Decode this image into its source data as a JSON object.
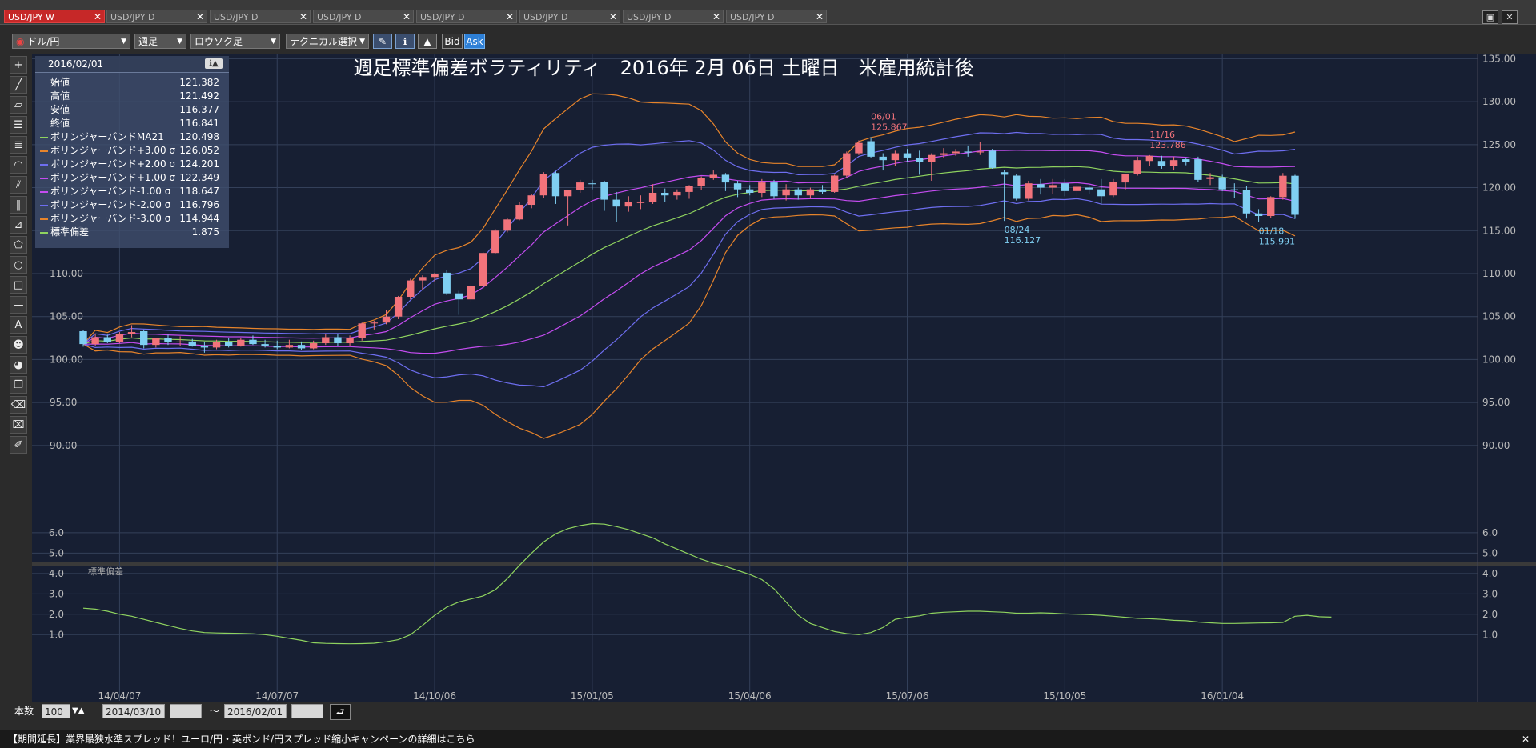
{
  "tabs": [
    {
      "label": "USD/JPY W",
      "active": true
    },
    {
      "label": "USD/JPY D",
      "active": false
    },
    {
      "label": "USD/JPY D",
      "active": false
    },
    {
      "label": "USD/JPY D",
      "active": false
    },
    {
      "label": "USD/JPY D",
      "active": false
    },
    {
      "label": "USD/JPY D",
      "active": false
    },
    {
      "label": "USD/JPY D",
      "active": false
    },
    {
      "label": "USD/JPY D",
      "active": false
    }
  ],
  "toolbar": {
    "pair": "ドル/円",
    "period": "週足",
    "chart_style": "ロウソク足",
    "technical": "テクニカル選択",
    "bid": "Bid",
    "ask": "Ask"
  },
  "info": {
    "date": "2016/02/01",
    "rows": [
      {
        "label": "始値",
        "value": "121.382",
        "color": ""
      },
      {
        "label": "高値",
        "value": "121.492",
        "color": ""
      },
      {
        "label": "安値",
        "value": "116.377",
        "color": ""
      },
      {
        "label": "終値",
        "value": "116.841",
        "color": ""
      },
      {
        "label": "ボリンジャーバンドMA21",
        "value": "120.498",
        "color": "#8fd35f"
      },
      {
        "label": "ボリンジャーバンド+3.00 σ",
        "value": "126.052",
        "color": "#e7842b"
      },
      {
        "label": "ボリンジャーバンド+2.00 σ",
        "value": "124.201",
        "color": "#6e6ef0"
      },
      {
        "label": "ボリンジャーバンド+1.00 σ",
        "value": "122.349",
        "color": "#c44cf0"
      },
      {
        "label": "ボリンジャーバンド-1.00 σ",
        "value": "118.647",
        "color": "#c44cf0"
      },
      {
        "label": "ボリンジャーバンド-2.00 σ",
        "value": "116.796",
        "color": "#6e6ef0"
      },
      {
        "label": "ボリンジャーバンド-3.00 σ",
        "value": "114.944",
        "color": "#e7842b"
      },
      {
        "label": "標準偏差",
        "value": "1.875",
        "color": "#8fd35f"
      }
    ]
  },
  "bottom": {
    "count_label": "本数",
    "count": "100",
    "from": "2014/03/10",
    "tilde": "～",
    "to": "2016/02/01"
  },
  "news": "【期間延長】業界最狭水準スプレッド！ユーロ/円・英ポンド/円スプレッド縮小キャンペーンの詳細はこちら",
  "chart_data": {
    "type": "line",
    "title": "週足標準偏差ボラティリティ　2016年 2月 06日 土曜日　米雇用統計後",
    "price_ylim": [
      88.5,
      135.5
    ],
    "price_yticks": [
      "135.00",
      "130.00",
      "125.00",
      "120.00",
      "115.00",
      "110.00",
      "105.00",
      "100.00",
      "95.00",
      "90.00"
    ],
    "std_ylim": [
      0.5,
      6.9
    ],
    "std_yticks": [
      "6.0",
      "5.0",
      "4.0",
      "3.0",
      "2.0",
      "1.0"
    ],
    "std_label": "標準偏差",
    "x_tick_labels": [
      {
        "label": "14/04/07",
        "index": 3
      },
      {
        "label": "14/07/07",
        "index": 16
      },
      {
        "label": "14/10/06",
        "index": 29
      },
      {
        "label": "15/01/05",
        "index": 42
      },
      {
        "label": "15/04/06",
        "index": 55
      },
      {
        "label": "15/07/06",
        "index": 68
      },
      {
        "label": "15/10/05",
        "index": 81
      },
      {
        "label": "16/01/04",
        "index": 94
      }
    ],
    "candles": [
      [
        103.3,
        103.4,
        101.5,
        101.8
      ],
      [
        101.8,
        103.0,
        101.6,
        102.6
      ],
      [
        102.6,
        102.9,
        101.9,
        102.0
      ],
      [
        102.0,
        103.2,
        101.9,
        103.0
      ],
      [
        103.0,
        104.0,
        102.6,
        103.2
      ],
      [
        103.3,
        103.5,
        101.3,
        101.7
      ],
      [
        101.7,
        102.5,
        101.4,
        102.5
      ],
      [
        102.5,
        102.9,
        101.7,
        102.0
      ],
      [
        102.0,
        102.7,
        101.6,
        102.1
      ],
      [
        102.1,
        102.4,
        101.5,
        101.6
      ],
      [
        101.6,
        102.0,
        100.8,
        101.4
      ],
      [
        101.4,
        102.3,
        101.2,
        102.0
      ],
      [
        102.0,
        102.5,
        101.4,
        101.6
      ],
      [
        101.6,
        102.5,
        101.5,
        102.3
      ],
      [
        102.3,
        102.8,
        101.7,
        101.8
      ],
      [
        101.8,
        102.3,
        101.4,
        101.6
      ],
      [
        101.6,
        102.2,
        101.2,
        101.4
      ],
      [
        101.4,
        102.3,
        101.3,
        101.7
      ],
      [
        101.7,
        102.1,
        101.1,
        101.3
      ],
      [
        101.3,
        102.2,
        101.2,
        101.9
      ],
      [
        101.9,
        103.0,
        101.7,
        102.6
      ],
      [
        102.6,
        103.0,
        101.6,
        101.9
      ],
      [
        101.9,
        102.8,
        101.6,
        102.5
      ],
      [
        102.5,
        104.3,
        102.2,
        104.2
      ],
      [
        104.2,
        104.5,
        103.5,
        104.3
      ],
      [
        104.3,
        105.8,
        104.1,
        105.0
      ],
      [
        105.0,
        107.4,
        104.7,
        107.3
      ],
      [
        107.3,
        109.4,
        107.0,
        109.2
      ],
      [
        109.2,
        109.8,
        108.1,
        109.6
      ],
      [
        109.6,
        110.1,
        109.0,
        110.0
      ],
      [
        110.1,
        110.4,
        107.5,
        107.7
      ],
      [
        107.7,
        108.0,
        105.2,
        107.0
      ],
      [
        107.0,
        108.8,
        106.7,
        108.6
      ],
      [
        108.6,
        112.5,
        108.3,
        112.4
      ],
      [
        112.4,
        115.2,
        112.3,
        115.0
      ],
      [
        115.0,
        116.5,
        114.8,
        116.3
      ],
      [
        116.3,
        118.3,
        116.2,
        118.0
      ],
      [
        118.0,
        119.3,
        117.6,
        119.1
      ],
      [
        119.1,
        121.8,
        118.8,
        121.6
      ],
      [
        121.7,
        121.9,
        118.1,
        119.0
      ],
      [
        119.0,
        119.7,
        115.6,
        119.7
      ],
      [
        119.7,
        120.9,
        119.4,
        120.6
      ],
      [
        120.5,
        120.9,
        119.8,
        120.4
      ],
      [
        120.7,
        120.8,
        117.3,
        118.6
      ],
      [
        118.6,
        119.5,
        116.0,
        117.8
      ],
      [
        117.8,
        119.0,
        117.2,
        118.3
      ],
      [
        118.3,
        119.1,
        117.5,
        118.3
      ],
      [
        118.3,
        120.4,
        118.1,
        119.4
      ],
      [
        119.4,
        119.9,
        118.3,
        119.1
      ],
      [
        119.1,
        119.8,
        118.6,
        119.5
      ],
      [
        119.5,
        120.3,
        118.7,
        120.2
      ],
      [
        120.2,
        121.3,
        119.7,
        121.1
      ],
      [
        121.1,
        122.0,
        120.9,
        121.5
      ],
      [
        121.5,
        121.7,
        119.6,
        120.6
      ],
      [
        120.5,
        120.8,
        118.9,
        119.8
      ],
      [
        119.8,
        120.3,
        119.1,
        119.4
      ],
      [
        119.4,
        121.0,
        118.9,
        120.6
      ],
      [
        120.6,
        120.9,
        118.7,
        119.0
      ],
      [
        119.1,
        120.4,
        118.5,
        119.8
      ],
      [
        119.8,
        120.0,
        118.6,
        119.1
      ],
      [
        119.1,
        120.0,
        118.7,
        119.8
      ],
      [
        119.8,
        120.3,
        119.3,
        119.5
      ],
      [
        119.5,
        121.5,
        119.4,
        121.4
      ],
      [
        121.4,
        124.2,
        121.2,
        124.0
      ],
      [
        124.0,
        125.5,
        123.8,
        125.2
      ],
      [
        125.4,
        125.867,
        123.5,
        123.6
      ],
      [
        123.6,
        124.0,
        122.0,
        123.2
      ],
      [
        123.2,
        124.3,
        122.5,
        124.0
      ],
      [
        124.0,
        124.5,
        123.0,
        123.5
      ],
      [
        123.4,
        124.3,
        121.5,
        123.0
      ],
      [
        123.0,
        124.0,
        120.8,
        123.8
      ],
      [
        123.8,
        124.6,
        123.4,
        124.0
      ],
      [
        124.0,
        124.5,
        123.7,
        124.2
      ],
      [
        124.2,
        124.9,
        123.6,
        124.1
      ],
      [
        124.1,
        125.3,
        123.8,
        124.2
      ],
      [
        124.3,
        124.5,
        122.2,
        122.3
      ],
      [
        121.8,
        122.1,
        116.127,
        121.5
      ],
      [
        121.4,
        121.6,
        118.5,
        118.7
      ],
      [
        118.7,
        120.8,
        118.5,
        120.5
      ],
      [
        120.4,
        121.0,
        119.2,
        120.0
      ],
      [
        120.0,
        121.0,
        119.3,
        120.3
      ],
      [
        120.5,
        121.0,
        119.0,
        119.6
      ],
      [
        119.6,
        120.5,
        118.7,
        120.1
      ],
      [
        120.0,
        120.3,
        119.3,
        119.8
      ],
      [
        119.8,
        121.0,
        118.1,
        119.0
      ],
      [
        119.1,
        121.0,
        118.9,
        120.7
      ],
      [
        120.6,
        121.5,
        119.8,
        121.6
      ],
      [
        121.6,
        123.6,
        121.4,
        123.2
      ],
      [
        123.1,
        123.786,
        122.5,
        123.7
      ],
      [
        123.1,
        123.7,
        122.2,
        122.5
      ],
      [
        122.5,
        123.6,
        122.0,
        123.2
      ],
      [
        123.3,
        123.5,
        122.6,
        123.0
      ],
      [
        123.3,
        123.6,
        120.7,
        120.9
      ],
      [
        121.0,
        121.7,
        120.3,
        121.2
      ],
      [
        121.2,
        121.5,
        119.6,
        119.8
      ],
      [
        119.8,
        120.5,
        118.8,
        119.7
      ],
      [
        119.7,
        120.2,
        116.4,
        117.0
      ],
      [
        117.0,
        117.5,
        115.991,
        116.7
      ],
      [
        116.7,
        119.0,
        116.5,
        118.9
      ],
      [
        118.9,
        121.7,
        118.6,
        121.382
      ],
      [
        121.382,
        121.492,
        116.377,
        116.841
      ]
    ],
    "std": [
      2.3,
      2.25,
      2.15,
      2.0,
      1.9,
      1.75,
      1.6,
      1.45,
      1.3,
      1.18,
      1.1,
      1.08,
      1.07,
      1.06,
      1.04,
      1.0,
      0.92,
      0.82,
      0.72,
      0.6,
      0.57,
      0.56,
      0.55,
      0.56,
      0.58,
      0.65,
      0.75,
      1.0,
      1.45,
      1.95,
      2.35,
      2.6,
      2.75,
      2.9,
      3.2,
      3.75,
      4.4,
      5.0,
      5.55,
      5.95,
      6.2,
      6.35,
      6.45,
      6.42,
      6.3,
      6.15,
      5.95,
      5.75,
      5.45,
      5.2,
      4.95,
      4.7,
      4.5,
      4.35,
      4.15,
      3.95,
      3.7,
      3.25,
      2.6,
      1.95,
      1.55,
      1.35,
      1.15,
      1.05,
      1.0,
      1.1,
      1.35,
      1.75,
      1.85,
      1.92,
      2.05,
      2.1,
      2.12,
      2.15,
      2.15,
      2.12,
      2.1,
      2.05,
      2.05,
      2.07,
      2.05,
      2.02,
      2.0,
      1.98,
      1.95,
      1.9,
      1.85,
      1.8,
      1.78,
      1.75,
      1.7,
      1.68,
      1.62,
      1.58,
      1.55,
      1.55,
      1.56,
      1.57,
      1.58,
      1.6,
      1.9,
      1.95,
      1.88,
      1.86
    ],
    "annotations": [
      {
        "date": "06/01",
        "value": "125.867",
        "index": 65,
        "kind": "high"
      },
      {
        "date": "11/16",
        "value": "123.786",
        "index": 88,
        "kind": "high"
      },
      {
        "date": "08/24",
        "value": "116.127",
        "index": 76,
        "kind": "low"
      },
      {
        "date": "01/18",
        "value": "115.991",
        "index": 97,
        "kind": "low"
      }
    ],
    "series_colors": {
      "up": "#f2737b",
      "down": "#7fcff2",
      "ma": "#8fd35f",
      "s1": "#c44cf0",
      "s2": "#6e6ef0",
      "s3": "#e7842b",
      "std": "#8fd35f"
    }
  }
}
